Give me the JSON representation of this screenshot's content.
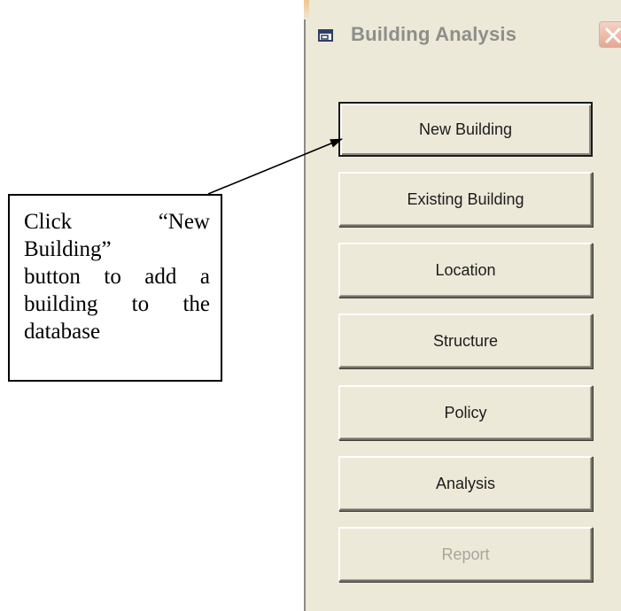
{
  "window": {
    "title": "Building Analysis",
    "icon": "app-window-icon",
    "close_icon": "close-icon"
  },
  "buttons": [
    {
      "label": "New Building",
      "state": "default"
    },
    {
      "label": "Existing Building",
      "state": "normal"
    },
    {
      "label": "Location",
      "state": "normal"
    },
    {
      "label": "Structure",
      "state": "normal"
    },
    {
      "label": "Policy",
      "state": "normal"
    },
    {
      "label": "Analysis",
      "state": "normal"
    },
    {
      "label": "Report",
      "state": "disabled"
    }
  ],
  "callout": {
    "lines": [
      [
        "Click",
        "“New"
      ],
      [
        "Building”"
      ],
      [
        "button",
        "to",
        "add",
        "a"
      ],
      [
        "building",
        "to",
        "the"
      ],
      [
        "database"
      ]
    ]
  },
  "colors": {
    "window_bg": "#ece9d8",
    "close_button": "#e5a893",
    "disabled_text": "#a8a69c"
  }
}
